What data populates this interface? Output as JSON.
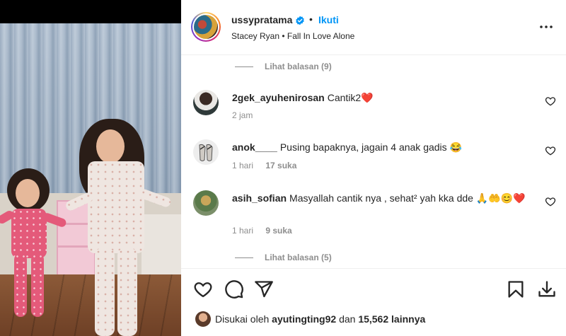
{
  "post": {
    "username": "ussypratama",
    "separator": "•",
    "follow_label": "Ikuti",
    "audio": "Stacey Ryan • Fall In Love Alone"
  },
  "comments": [
    {
      "type": "replies",
      "label": "Lihat balasan (9)"
    },
    {
      "type": "comment",
      "user": "2gek_ayuhenirosan",
      "text": "Cantik2❤️",
      "time": "2 jam",
      "likes": ""
    },
    {
      "type": "comment",
      "user": "anok____",
      "text": "Pusing bapaknya, jagain 4 anak gadis 😂",
      "time": "1 hari",
      "likes": "17 suka"
    },
    {
      "type": "comment",
      "user": "asih_sofian",
      "text": "Masyallah cantik nya , sehat² yah kka dde 🙏🤲😊❤️",
      "time": "1 hari",
      "likes": "9 suka"
    },
    {
      "type": "replies",
      "label": "Lihat balasan (5)"
    }
  ],
  "likes_line": {
    "prefix": "Disukai oleh",
    "user": "ayutingting92",
    "middle": "dan",
    "count": "15,562",
    "suffix": "lainnya"
  },
  "icons": {
    "verified": "verified-badge-icon",
    "more": "more-options-icon",
    "like": "heart-icon",
    "comment": "comment-bubble-icon",
    "share": "paper-plane-icon",
    "save": "bookmark-icon",
    "download": "download-icon"
  },
  "colors": {
    "accent": "#0095f6",
    "text": "#262626",
    "muted": "#8e8e8e",
    "divider": "#efefef"
  }
}
